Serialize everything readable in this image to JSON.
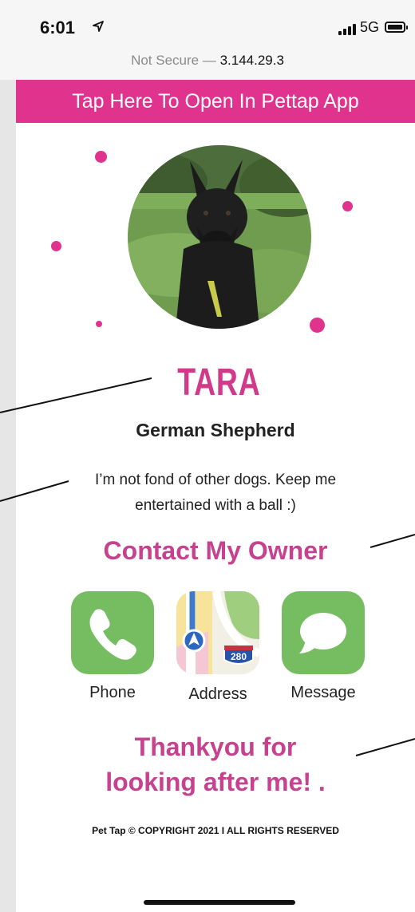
{
  "status_bar": {
    "time": "6:01",
    "network": "5G"
  },
  "url_bar": {
    "security_label": "Not Secure —",
    "address": "3.144.29.3"
  },
  "banner": {
    "label": "Tap Here To Open In Pettap App"
  },
  "pet": {
    "name": "TARA",
    "breed": "German Shepherd",
    "bio": "I’m not fond of other dogs. Keep me entertained with a ball :)"
  },
  "contact": {
    "heading": "Contact My Owner",
    "actions": [
      {
        "label": "Phone",
        "icon": "phone-icon"
      },
      {
        "label": "Address",
        "icon": "maps-icon",
        "badge": "280"
      },
      {
        "label": "Message",
        "icon": "message-icon"
      }
    ]
  },
  "thanks": {
    "line1": "Thankyou for",
    "line2": "looking after me! ."
  },
  "footer": {
    "text": "Pet Tap © COPYRIGHT 2021 I ALL RIGHTS RESERVED"
  },
  "colors": {
    "brand_pink": "#e0338d",
    "heading_pink": "#c6428e",
    "icon_green": "#76bd62"
  }
}
